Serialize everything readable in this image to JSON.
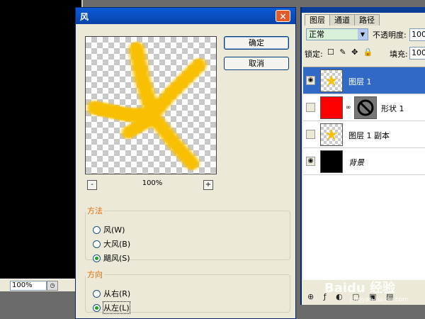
{
  "document": {
    "zoom": "100%"
  },
  "dialog": {
    "title": "风",
    "close_label": "×",
    "ok_label": "确定",
    "cancel_label": "取消",
    "zoom_out_label": "-",
    "zoom_in_label": "+",
    "zoom_percent": "100%",
    "method": {
      "legend": "方法",
      "options": [
        {
          "label": "风(W)",
          "selected": false
        },
        {
          "label": "大风(B)",
          "selected": false
        },
        {
          "label": "飓风(S)",
          "selected": true
        }
      ]
    },
    "direction": {
      "legend": "方向",
      "options": [
        {
          "label": "从右(R)",
          "selected": false
        },
        {
          "label": "从左(L)",
          "selected": true
        }
      ]
    },
    "preview_color": "#f8c000"
  },
  "layers_panel": {
    "tabs": [
      "图层",
      "通道",
      "路径"
    ],
    "blend_mode": "正常",
    "opacity_label": "不透明度:",
    "opacity_value": "100",
    "lock_label": "锁定:",
    "lock_icons": "☐ ✎ ✥ 🔒",
    "fill_label": "填充:",
    "fill_value": "100",
    "layers": [
      {
        "name": "图层 1",
        "visible": true,
        "selected": true
      },
      {
        "name": "形状 1",
        "visible": false,
        "selected": false
      },
      {
        "name": "图层 1 副本",
        "visible": false,
        "selected": false
      },
      {
        "name": "背景",
        "visible": true,
        "selected": false
      }
    ],
    "footer_icons": "⊕ ƒ ◐ ▢ ▣ ▤"
  },
  "watermark": {
    "main": "Baidu 经验",
    "sub": "jingyan.baidu.com"
  }
}
